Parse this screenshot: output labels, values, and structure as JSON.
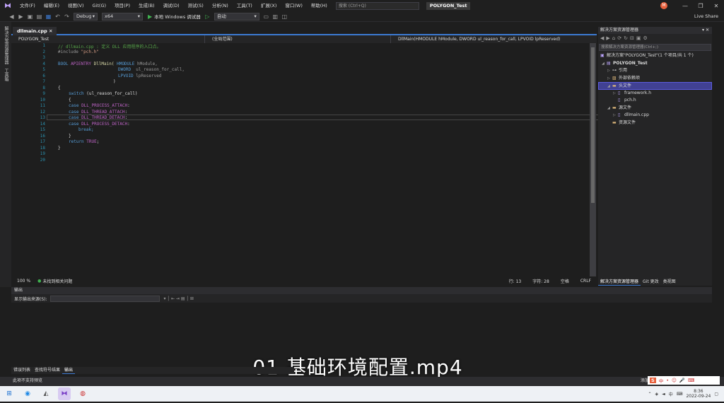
{
  "menubar": {
    "items": [
      "文件(F)",
      "编辑(E)",
      "视图(V)",
      "Git(G)",
      "项目(P)",
      "生成(B)",
      "调试(D)",
      "测试(S)",
      "分析(N)",
      "工具(T)",
      "扩展(X)",
      "窗口(W)",
      "帮助(H)"
    ],
    "search_placeholder": "搜索 (Ctrl+Q)",
    "solution_title": "POLYGON_Test",
    "avatar_letter": "M",
    "win_min": "—",
    "win_max": "❐",
    "win_close": "✕"
  },
  "toolbar": {
    "config": "Debug",
    "platform": "x64",
    "run_label": "本地 Windows 调试器",
    "auto_label": "自动",
    "live_share": "Live Share"
  },
  "leftstrip": {
    "label1": "解决方案资源管理器",
    "label2": "工具箱"
  },
  "editor": {
    "tab": "dllmain.cpp",
    "nav_project": "POLYGON_Test",
    "nav_scope": "(全局范围)",
    "nav_function": "DllMain(HMODULE hModule, DWORD ul_reason_for_call, LPVOID lpReserved)",
    "line_numbers": [
      "1",
      "2",
      "3",
      "4",
      "5",
      "6",
      "7",
      "8",
      "9",
      "10",
      "11",
      "12",
      "13",
      "14",
      "15",
      "16",
      "17",
      "18",
      "19",
      "20"
    ],
    "zoom": "100 %",
    "issues": "未找到相关问题",
    "row": "行: 13",
    "col": "字符: 28",
    "spaces": "空格",
    "eol": "CRLF"
  },
  "code": {
    "l1": "// dllmain.cpp : 定义 DLL 应用程序的入口点。",
    "l2a": "#include ",
    "l2b": "\"pch.h\"",
    "l4a": "BOOL ",
    "l4b": "APIENTRY ",
    "l4c": "DllMain( ",
    "l4d": "HMODULE ",
    "l4e": "hModule,",
    "l5a": "DWORD  ",
    "l5b": "ul_reason_for_call,",
    "l6a": "LPVOID ",
    "l6b": "lpReserved",
    "l7": ")",
    "l8": "{",
    "l9a": "switch ",
    "l9b": "(ul_reason_for_call)",
    "l10": "{",
    "l11a": "case ",
    "l11b": "DLL_PROCESS_ATTACH",
    "l11c": ":",
    "l12b": "DLL_THREAD_ATTACH",
    "l13b": "DLL_THREAD_DETACH",
    "l14b": "DLL_PROCESS_DETACH",
    "l15": "break;",
    "l16": "}",
    "l17a": "return ",
    "l17b": "TRUE",
    "l17c": ";",
    "l18": "}"
  },
  "solution": {
    "header": "解决方案资源管理器",
    "search_placeholder": "搜索解决方案资源管理器(Ctrl+;)",
    "root": "解决方案\"POLYGON_Test\"(1 个项目/共 1 个)",
    "project": "POLYGON_Test",
    "items": [
      "引用",
      "外部依赖项",
      "头文件",
      "framework.h",
      "pch.h",
      "源文件",
      "dllmain.cpp",
      "资源文件"
    ],
    "tabs": [
      "解决方案资源管理器",
      "Git 更改",
      "类视图"
    ]
  },
  "output": {
    "header": "输出",
    "source_label": "显示输出来源(S):",
    "bottom_tabs": [
      "错误列表",
      "查找符号结果",
      "输出"
    ]
  },
  "caption": "01 基础环境配置.mp4",
  "status": {
    "left": "此项不支持预览",
    "right": "添加到源代码管理"
  },
  "ime": {
    "items": [
      "中",
      "•",
      "☺",
      "🎤",
      "⌨"
    ]
  },
  "taskbar": {
    "tray_lang": "中",
    "time": "8:36",
    "date": "2022-09-24"
  }
}
